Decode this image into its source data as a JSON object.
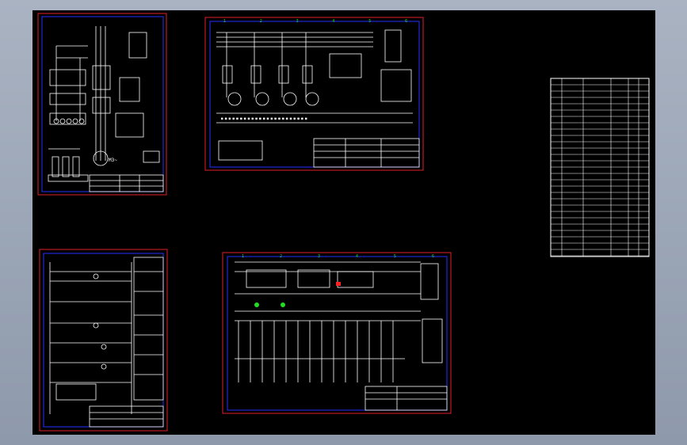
{
  "viewport": {
    "background": "#000000",
    "frame_color": "#9aa5b6"
  },
  "colors": {
    "border_outer": "#e0202a",
    "border_inner": "#2430ff",
    "line": "#ffffff",
    "accent_green": "#22dd22",
    "accent_red": "#ff2020"
  },
  "sheets": [
    {
      "name": "sheet-main-circuit"
    },
    {
      "name": "sheet-distribution"
    },
    {
      "name": "sheet-parts-table"
    },
    {
      "name": "sheet-control-circuit"
    },
    {
      "name": "sheet-plc-wiring"
    }
  ],
  "tick_labels": {
    "numbers": [
      "1",
      "2",
      "3",
      "4",
      "5",
      "6"
    ],
    "letters": [
      "A",
      "B",
      "C",
      "D"
    ]
  },
  "labels": {
    "motor_label": "M3~"
  }
}
